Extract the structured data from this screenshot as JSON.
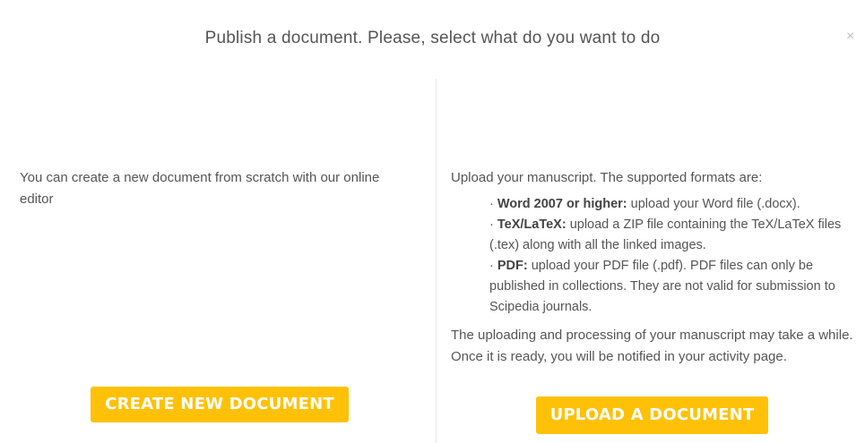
{
  "modal": {
    "title": "Publish a document. Please, select what do you want to do",
    "close_symbol": "×"
  },
  "left": {
    "description": "You can create a new document from scratch with our online editor",
    "button_label": "CREATE NEW DOCUMENT"
  },
  "right": {
    "intro": "Upload your manuscript. The supported formats are:",
    "formats": [
      {
        "bullet": "· ",
        "name": "Word 2007 or higher:",
        "text": " upload your Word file (.docx)."
      },
      {
        "bullet": "· ",
        "name": "TeX/LaTeX:",
        "text": " upload a ZIP file containing the TeX/LaTeX files (.tex) along with all the linked images."
      },
      {
        "bullet": "· ",
        "name": "PDF:",
        "text": " upload your PDF file (.pdf). PDF files can only be published in collections. They are not valid for submission to Scipedia journals."
      }
    ],
    "note": "The uploading and processing of your manuscript may take a while. Once it is ready, you will be notified in your activity page.",
    "button_label": "UPLOAD A DOCUMENT"
  },
  "colors": {
    "button_bg": "#ffc107",
    "button_text": "#ffffff",
    "body_text": "#555555"
  }
}
